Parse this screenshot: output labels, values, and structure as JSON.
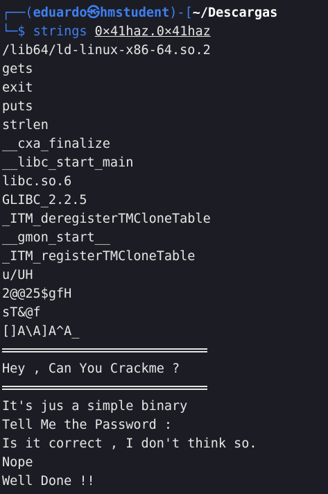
{
  "prompt": {
    "frame_top_left": "┌──(",
    "user": "eduardo",
    "at_symbol": "㉿",
    "host": "hmstudent",
    "frame_mid": ")-[",
    "cwd": "~/Descargas",
    "frame_bottom_left": "└─$ ",
    "command": "strings",
    "argument": "0×41haz.0×41haz"
  },
  "output": [
    "/lib64/ld-linux-x86-64.so.2",
    "gets",
    "exit",
    "puts",
    "strlen",
    "__cxa_finalize",
    "__libc_start_main",
    "libc.so.6",
    "GLIBC_2.2.5",
    "_ITM_deregisterTMCloneTable",
    "__gmon_start__",
    "_ITM_registerTMCloneTable",
    "u/UH",
    "2@@25$gfH",
    "sT&@f",
    "[]A\\A]A^A_",
    "",
    "Hey , Can You Crackme ?",
    "",
    "It's jus a simple binary",
    "Tell Me the Password :",
    "Is it correct , I don't think so.",
    "Nope",
    "Well Done !!"
  ]
}
